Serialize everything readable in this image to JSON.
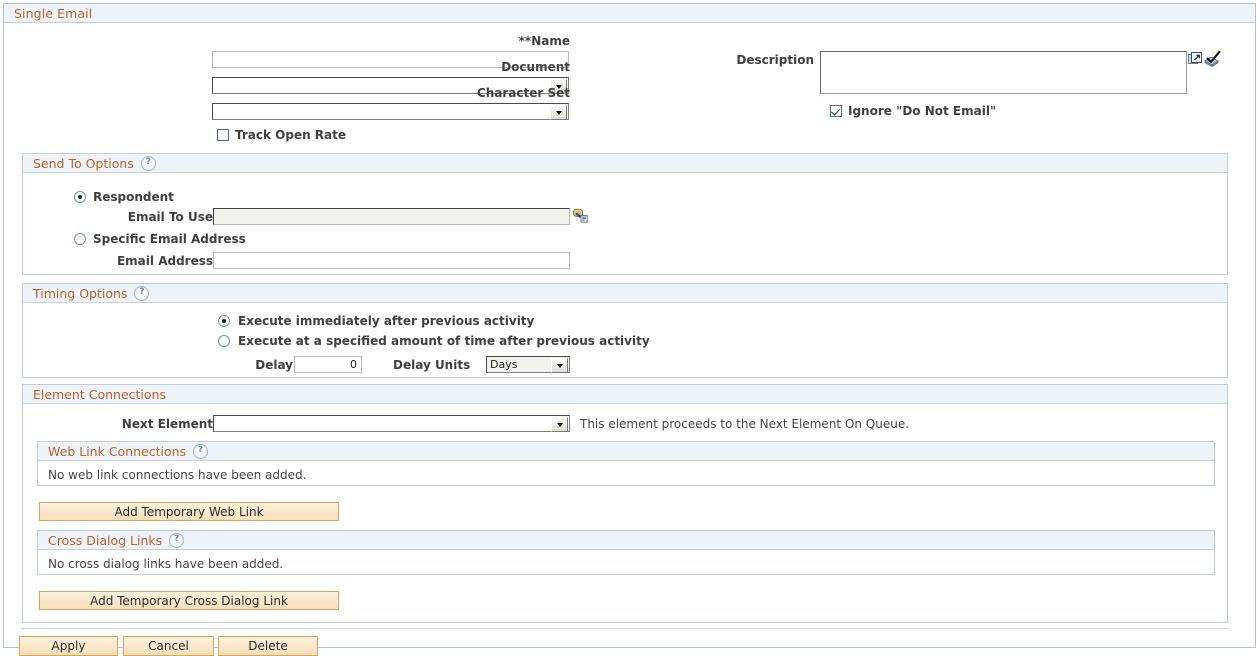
{
  "panel": {
    "title": "Single Email"
  },
  "top_form": {
    "name_label": "**Name",
    "name_value": "",
    "document_label": "Document",
    "document_value": "",
    "character_set_label": "Character Set",
    "character_set_value": "",
    "track_open_rate_label": "Track Open Rate",
    "track_open_rate_checked": false,
    "description_label": "Description",
    "description_value": "",
    "ignore_do_not_email_label": "Ignore \"Do Not Email\"",
    "ignore_do_not_email_checked": true,
    "expand_icon": "expand-popup-icon",
    "spellcheck_icon": "spell-check-icon"
  },
  "send_to_options": {
    "title": "Send To Options",
    "help_icon": "?",
    "respondent_label": "Respondent",
    "respondent_selected": true,
    "email_to_use_label": "Email To Use",
    "email_to_use_value": "",
    "email_to_use_picker_icon": "field-picker-icon",
    "specific_email_label": "Specific Email Address",
    "specific_email_selected": false,
    "email_address_label": "Email Address",
    "email_address_value": ""
  },
  "timing_options": {
    "title": "Timing Options",
    "help_icon": "?",
    "immediate_label": "Execute immediately after previous activity",
    "immediate_selected": true,
    "delayed_label": "Execute at a specified amount of time after previous activity",
    "delayed_selected": false,
    "delay_label": "Delay",
    "delay_value": "0",
    "delay_units_label": "Delay Units",
    "delay_units_value": "Days"
  },
  "element_connections": {
    "title": "Element Connections",
    "next_element_label": "Next Element",
    "next_element_value": "",
    "next_element_note": "This element proceeds to the Next Element On Queue.",
    "web_link": {
      "title": "Web Link Connections",
      "help_icon": "?",
      "empty_text": "No web link connections have been added.",
      "add_button": "Add Temporary Web Link"
    },
    "cross_dialog": {
      "title": "Cross Dialog Links",
      "help_icon": "?",
      "empty_text": "No cross dialog links have been added.",
      "add_button": "Add Temporary Cross Dialog Link"
    }
  },
  "footer": {
    "apply_label": "Apply",
    "cancel_label": "Cancel",
    "delete_label": "Delete"
  },
  "colors": {
    "header_text": "#c0622b",
    "header_bg": "#eef3f7",
    "button_border": "#d9a35c",
    "panel_border": "#b6c2cf"
  }
}
